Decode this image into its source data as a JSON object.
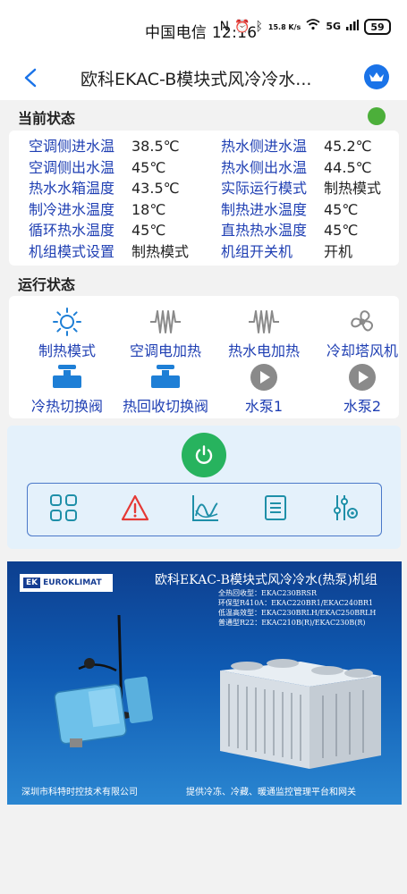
{
  "status_bar": {
    "carrier_time": "中国电信 12:16",
    "net_speed": "15.8 K/s",
    "battery": "59",
    "signal": "5G"
  },
  "header": {
    "title": "欧科EKAC-B模块式风冷冷水...",
    "back_icon": "chevron-left-icon",
    "crown_icon": "crown-icon"
  },
  "current_status": {
    "label": "当前状态",
    "indicator_color": "#4caf3a",
    "rows": [
      {
        "l1": "空调侧进水温",
        "v1": "38.5℃",
        "l2": "热水侧进水温",
        "v2": "45.2℃"
      },
      {
        "l1": "空调侧出水温",
        "v1": "45℃",
        "l2": "热水侧出水温",
        "v2": "44.5℃"
      },
      {
        "l1": "热水水箱温度",
        "v1": "43.5℃",
        "l2": "实际运行模式",
        "v2": "制热模式"
      },
      {
        "l1": "制冷进水温度",
        "v1": "18℃",
        "l2": "制热进水温度",
        "v2": "45℃"
      },
      {
        "l1": "循环热水温度",
        "v1": "45℃",
        "l2": "直热热水温度",
        "v2": "45℃"
      },
      {
        "l1": "机组模式设置",
        "v1": "制热模式",
        "l2": "机组开关机",
        "v2": "开机"
      }
    ]
  },
  "run_status": {
    "label": "运行状态",
    "items": [
      {
        "label": "制热模式",
        "icon": "sun-icon"
      },
      {
        "label": "空调电加热",
        "icon": "heater-icon"
      },
      {
        "label": "热水电加热",
        "icon": "heater-icon"
      },
      {
        "label": "冷却塔风机",
        "icon": "fan-icon"
      },
      {
        "label": "冷热切换阀",
        "icon": "valve-icon"
      },
      {
        "label": "热回收切换阀",
        "icon": "valve-icon"
      },
      {
        "label": "水泵1",
        "icon": "pump-icon"
      },
      {
        "label": "水泵2",
        "icon": "pump-icon"
      }
    ]
  },
  "controls": {
    "power_icon": "power-icon",
    "toolbar": [
      "grid-icon",
      "warning-icon",
      "chart-icon",
      "list-icon",
      "settings-sliders-icon"
    ]
  },
  "banner": {
    "title": "欧科EKAC-B模块式风冷冷水(热泵)机组",
    "logo_ek": "EK",
    "logo_word": "EUROKLIMAT",
    "specs": [
      "全热回收型：EKAC230BRSR",
      "环保型R410A：EKAC220BR1/EKAC240BR1",
      "低温高效型：EKAC230BRLH/EKAC250BRLH",
      "普通型R22：EKAC210B(R)/EKAC230B(R)"
    ],
    "footer_left": "深圳市科特时控技术有限公司",
    "footer_right": "提供冷冻、冷藏、暖通监控管理平台和网关"
  }
}
